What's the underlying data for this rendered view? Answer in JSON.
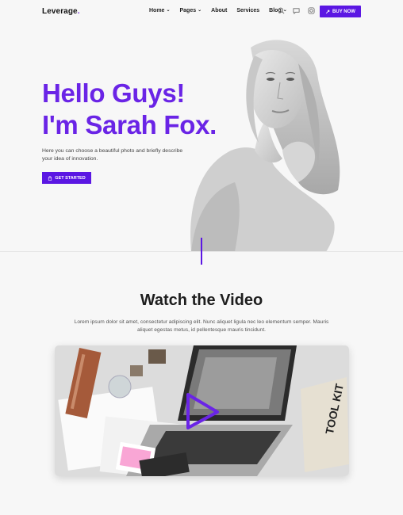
{
  "header": {
    "logo": "Leverage",
    "logo_dot": ".",
    "nav": [
      {
        "label": "Home",
        "dropdown": true
      },
      {
        "label": "Pages",
        "dropdown": true
      },
      {
        "label": "About",
        "dropdown": false
      },
      {
        "label": "Services",
        "dropdown": false
      },
      {
        "label": "Blog",
        "dropdown": true
      }
    ],
    "icons": [
      "search-icon",
      "chat-icon",
      "instagram-icon"
    ],
    "buy_label": "BUY NOW"
  },
  "hero": {
    "title_line1": "Hello Guys!",
    "title_line2": "I'm Sarah Fox.",
    "subtitle": "Here you can choose a beautiful photo and briefly describe your idea of innovation.",
    "cta_label": "GET STARTED"
  },
  "video": {
    "title": "Watch the Video",
    "description": "Lorem ipsum dolor sit amet, consectetur adipiscing elit. Nunc aliquet ligula nec leo elementum semper. Mauris aliquet egestas metus, id pellentesque mauris tincidunt.",
    "bag_text": "TOOL KIT"
  },
  "colors": {
    "accent": "#5b17e3",
    "title": "#6a24e6"
  }
}
